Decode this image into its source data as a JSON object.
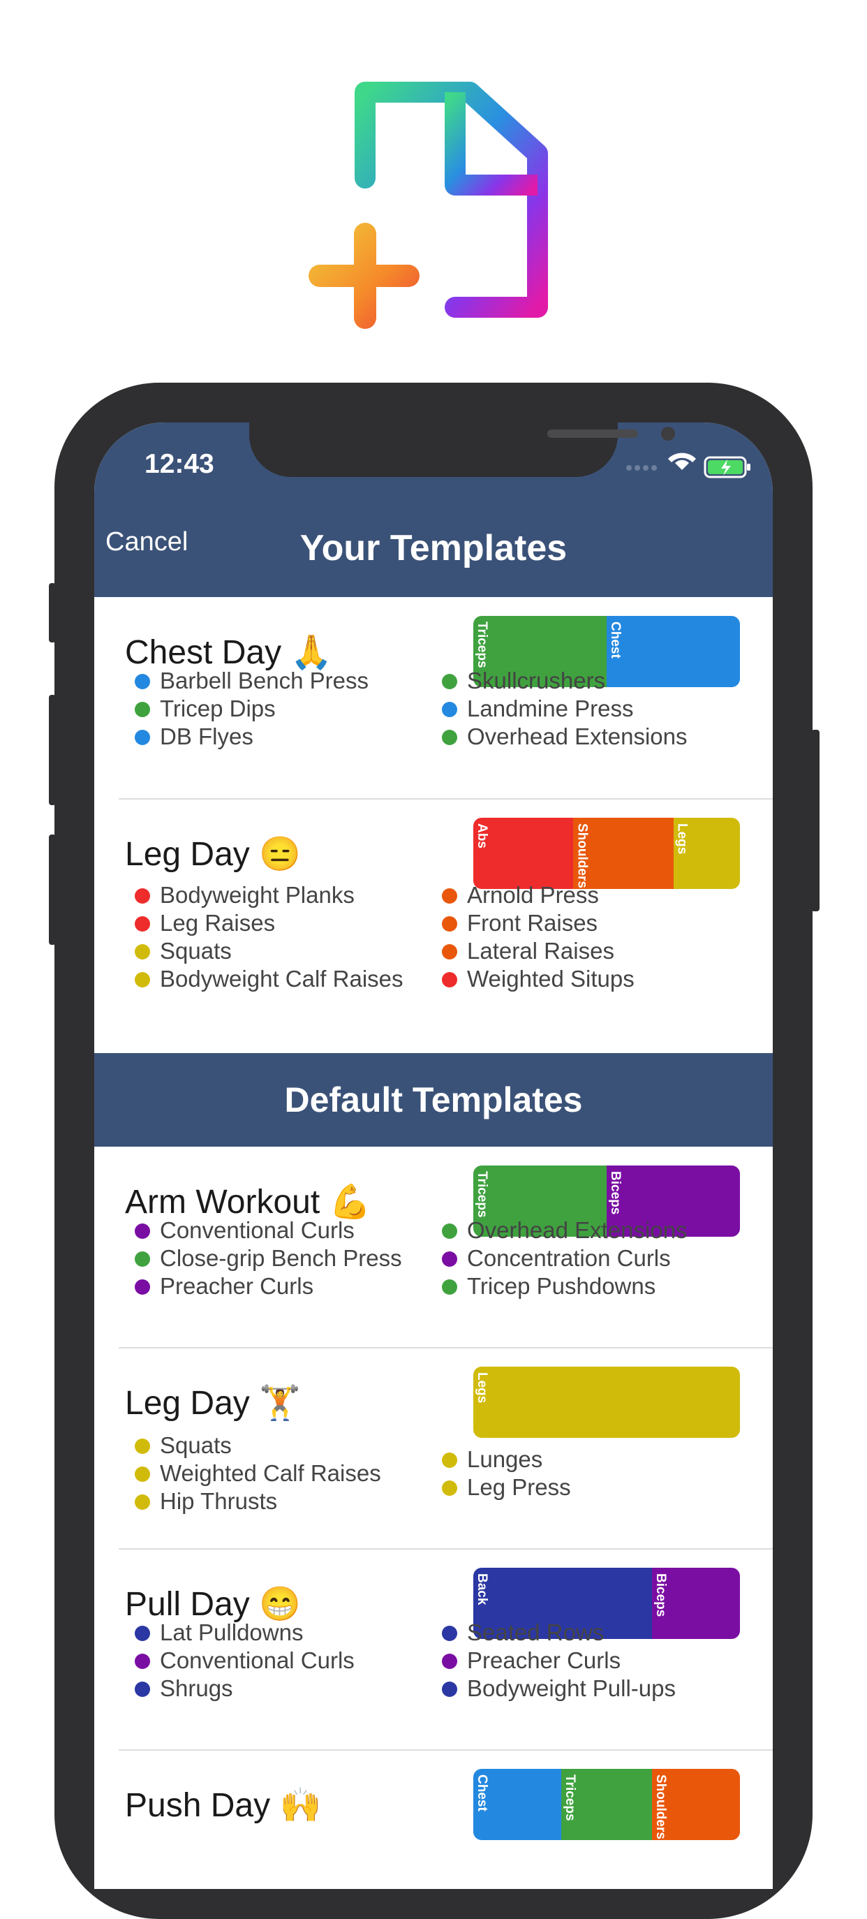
{
  "colors": {
    "nav_bg": "#3b5278",
    "triceps": "#3fa23f",
    "chest": "#2388e0",
    "abs": "#ee2c2c",
    "shoulders": "#e9570b",
    "legs": "#d1bb0a",
    "biceps": "#7a0ea3",
    "back": "#2b37a3"
  },
  "icons": [
    "new-document-icon",
    "wifi-icon",
    "battery-charging-icon",
    "cellular-signal-icon"
  ],
  "status": {
    "time": "12:43"
  },
  "nav": {
    "cancel": "Cancel",
    "title": "Your Templates"
  },
  "section": {
    "default_title": "Default Templates"
  },
  "templates": [
    {
      "name": "Chest Day 🙏",
      "bar": [
        {
          "label": "Triceps",
          "value": 0.5,
          "color": "#3fa23f"
        },
        {
          "label": "Chest",
          "value": 0.5,
          "color": "#2388e0"
        }
      ],
      "left": [
        {
          "name": "Barbell Bench Press",
          "color": "#2388e0"
        },
        {
          "name": "Tricep Dips",
          "color": "#3fa23f"
        },
        {
          "name": "DB Flyes",
          "color": "#2388e0"
        }
      ],
      "right": [
        {
          "name": "Skullcrushers",
          "color": "#3fa23f"
        },
        {
          "name": "Landmine Press",
          "color": "#2388e0"
        },
        {
          "name": "Overhead Extensions",
          "color": "#3fa23f"
        }
      ]
    },
    {
      "name": "Leg Day 😑",
      "bar": [
        {
          "label": "Abs",
          "value": 0.375,
          "color": "#ee2c2c"
        },
        {
          "label": "Shoulders",
          "value": 0.375,
          "color": "#e9570b"
        },
        {
          "label": "Legs",
          "value": 0.25,
          "color": "#d1bb0a"
        }
      ],
      "left": [
        {
          "name": "Bodyweight Planks",
          "color": "#ee2c2c"
        },
        {
          "name": "Leg Raises",
          "color": "#ee2c2c"
        },
        {
          "name": "Squats",
          "color": "#d1bb0a"
        },
        {
          "name": "Bodyweight Calf Raises",
          "color": "#d1bb0a"
        }
      ],
      "right": [
        {
          "name": "Arnold Press",
          "color": "#e9570b"
        },
        {
          "name": "Front Raises",
          "color": "#e9570b"
        },
        {
          "name": "Lateral Raises",
          "color": "#e9570b"
        },
        {
          "name": "Weighted Situps",
          "color": "#ee2c2c"
        }
      ]
    },
    {
      "name": "Arm Workout 💪",
      "bar": [
        {
          "label": "Triceps",
          "value": 0.5,
          "color": "#3fa23f"
        },
        {
          "label": "Biceps",
          "value": 0.5,
          "color": "#7a0ea3"
        }
      ],
      "left": [
        {
          "name": "Conventional Curls",
          "color": "#7a0ea3"
        },
        {
          "name": "Close-grip Bench Press",
          "color": "#3fa23f"
        },
        {
          "name": "Preacher Curls",
          "color": "#7a0ea3"
        }
      ],
      "right": [
        {
          "name": "Overhead Extensions",
          "color": "#3fa23f"
        },
        {
          "name": "Concentration Curls",
          "color": "#7a0ea3"
        },
        {
          "name": "Tricep Pushdowns",
          "color": "#3fa23f"
        }
      ]
    },
    {
      "name": "Leg Day 🏋️",
      "bar": [
        {
          "label": "Legs",
          "value": 1.0,
          "color": "#d1bb0a"
        }
      ],
      "left": [
        {
          "name": "Squats",
          "color": "#d1bb0a"
        },
        {
          "name": "Weighted Calf Raises",
          "color": "#d1bb0a"
        },
        {
          "name": "Hip Thrusts",
          "color": "#d1bb0a"
        }
      ],
      "right": [
        {
          "name": "Lunges",
          "color": "#d1bb0a"
        },
        {
          "name": "Leg Press",
          "color": "#d1bb0a"
        }
      ]
    },
    {
      "name": "Pull Day 😁",
      "bar": [
        {
          "label": "Back",
          "value": 0.67,
          "color": "#2b37a3"
        },
        {
          "label": "Biceps",
          "value": 0.33,
          "color": "#7a0ea3"
        }
      ],
      "left": [
        {
          "name": "Lat Pulldowns",
          "color": "#2b37a3"
        },
        {
          "name": "Conventional Curls",
          "color": "#7a0ea3"
        },
        {
          "name": "Shrugs",
          "color": "#2b37a3"
        }
      ],
      "right": [
        {
          "name": "Seated Rows",
          "color": "#2b37a3"
        },
        {
          "name": "Preacher Curls",
          "color": "#7a0ea3"
        },
        {
          "name": "Bodyweight Pull-ups",
          "color": "#2b37a3"
        }
      ]
    },
    {
      "name": "Push Day 🙌",
      "bar": [
        {
          "label": "Chest",
          "value": 0.33,
          "color": "#2388e0"
        },
        {
          "label": "Triceps",
          "value": 0.34,
          "color": "#3fa23f"
        },
        {
          "label": "Shoulders",
          "value": 0.33,
          "color": "#e9570b"
        }
      ],
      "left": [],
      "right": []
    }
  ]
}
